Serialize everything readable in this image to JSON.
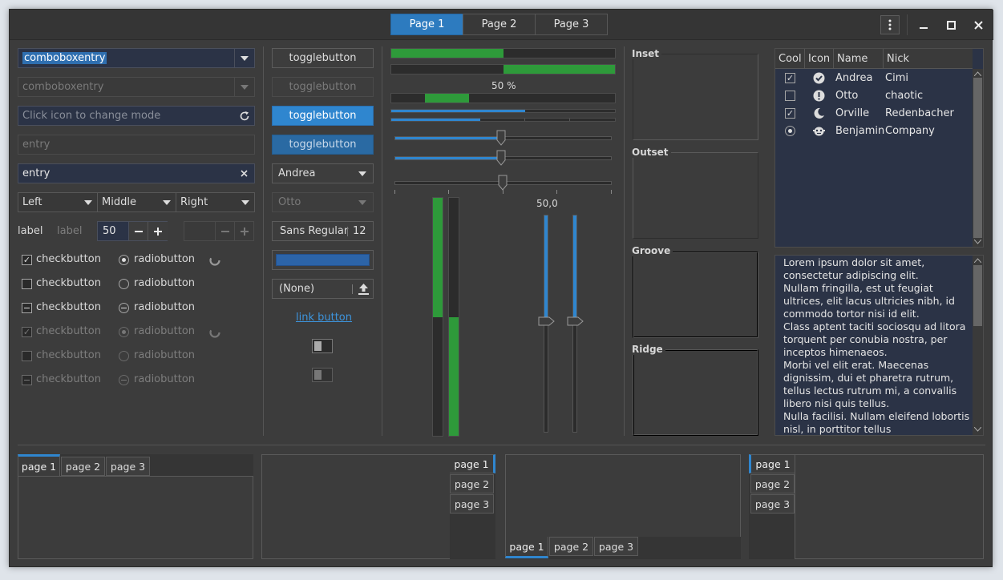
{
  "header": {
    "tabs": [
      "Page 1",
      "Page 2",
      "Page 3"
    ],
    "menu_icon": "kebab-menu-icon",
    "minimize": "–",
    "maximize": "□",
    "close": "✕"
  },
  "col1": {
    "combo1": "comboboxentry",
    "combo2": "comboboxentry",
    "mode_placeholder": "Click icon to change mode",
    "entry_dis": "entry",
    "entry": "entry",
    "seg": [
      "Left",
      "Middle",
      "Right"
    ],
    "label1": "label",
    "label2": "label",
    "spin_value": "50",
    "checks": [
      "checkbutton",
      "checkbutton",
      "checkbutton",
      "checkbutton",
      "checkbutton",
      "checkbutton"
    ],
    "radios": [
      "radiobutton",
      "radiobutton",
      "radiobutton",
      "radiobutton",
      "radiobutton",
      "radiobutton"
    ]
  },
  "col2": {
    "toggles": [
      "togglebutton",
      "togglebutton",
      "togglebutton",
      "togglebutton"
    ],
    "combo_andrea": "Andrea",
    "combo_otto": "Otto",
    "font_name": "Sans Regular",
    "font_size": "12",
    "file_none": "(None)",
    "link": "link button"
  },
  "col3": {
    "progress_text": "50 %",
    "scale_value": "50,0",
    "progress": [
      0.5,
      0.5,
      0.5
    ],
    "scales": [
      0.5,
      0.5,
      0.5
    ],
    "vbars": [
      0.5,
      0.5
    ],
    "vscales": [
      0.5,
      0.5
    ]
  },
  "frames": [
    "Inset",
    "Outset",
    "Groove",
    "Ridge"
  ],
  "tree": {
    "columns": [
      "Cool",
      "Icon",
      "Name",
      "Nick"
    ],
    "rows": [
      {
        "cool": "✓",
        "icon": "check-circle-icon",
        "glyph": "✔",
        "name": "Andrea",
        "nick": "Cimi"
      },
      {
        "cool": "",
        "icon": "warning-icon",
        "glyph": "!",
        "name": "Otto",
        "nick": "chaotic"
      },
      {
        "cool": "✓",
        "icon": "moon-icon",
        "glyph": "☾",
        "name": "Orville",
        "nick": "Redenbacher"
      },
      {
        "cool": "◉",
        "icon": "face-icon",
        "glyph": "☺",
        "name": "Benjamin",
        "nick": "Company"
      }
    ]
  },
  "text": "Lorem ipsum dolor sit amet, consectetur adipiscing elit.\nNullam fringilla, est ut feugiat ultrices, elit lacus ultricies nibh, id commodo tortor nisi id elit.\nClass aptent taciti sociosqu ad litora torquent per conubia nostra, per inceptos himenaeos.\nMorbi vel elit erat. Maecenas dignissim, dui et pharetra rutrum, tellus lectus rutrum mi, a convallis libero nisi quis tellus.\nNulla facilisi. Nullam eleifend lobortis nisl, in porttitor tellus",
  "notebooks": {
    "nb1": [
      "page 1",
      "page 2",
      "page 3"
    ],
    "nb2": [
      "page 1",
      "page 2",
      "page 3"
    ],
    "nb3": [
      "page 1",
      "page 2",
      "page 3"
    ],
    "nb4": [
      "page 1",
      "page 2",
      "page 3"
    ]
  },
  "colors": {
    "accent": "#2f86cf",
    "progress": "#2e9a3a",
    "view_bg": "#2b3346"
  }
}
